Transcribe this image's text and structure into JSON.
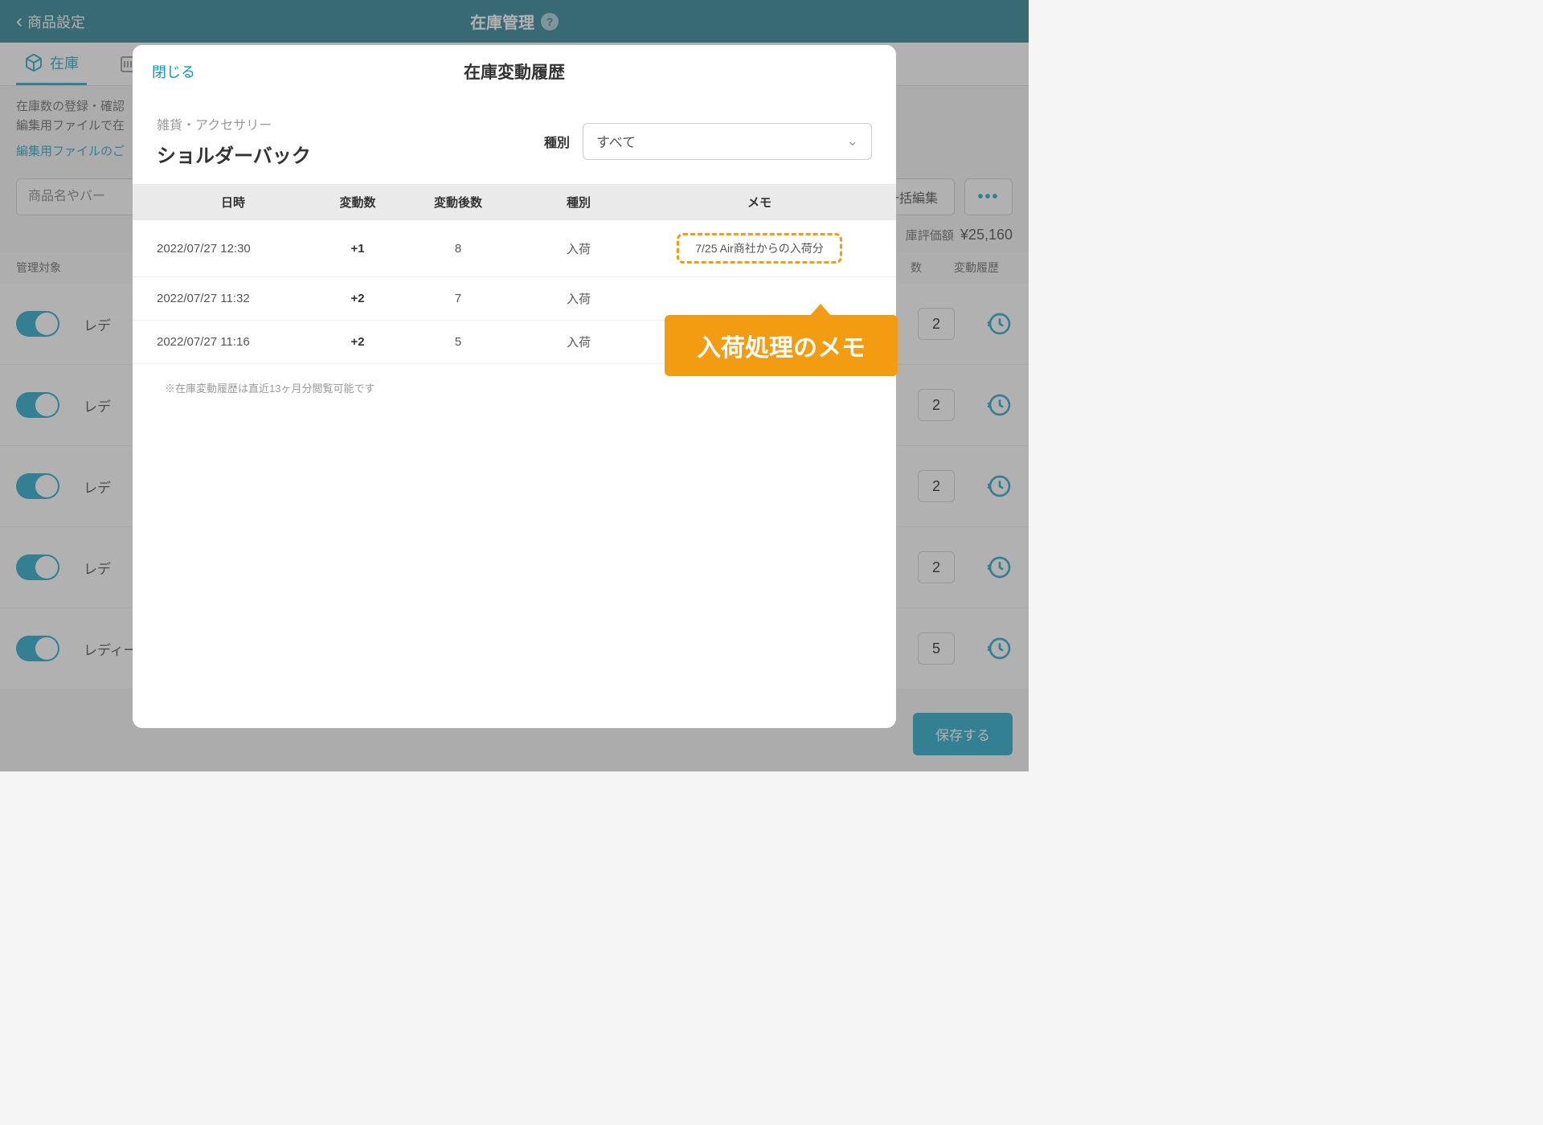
{
  "header": {
    "back_label": "商品設定",
    "title": "在庫管理"
  },
  "tabs": {
    "stock": "在庫"
  },
  "description": {
    "line1": "在庫数の登録・確認",
    "line2": "編集用ファイルで在",
    "link": "編集用ファイルのご"
  },
  "search": {
    "placeholder": "商品名やバー",
    "bulk_label": "一括編集",
    "more_label": "•••"
  },
  "summary": {
    "label": "庫評価額",
    "value": "¥25,160"
  },
  "table": {
    "col_target": "管理対象",
    "col_count": "数",
    "col_history": "変動履歴",
    "rows": [
      {
        "name": "レデ",
        "count": "2"
      },
      {
        "name": "レデ",
        "count": "2"
      },
      {
        "name": "レデ",
        "count": "2"
      },
      {
        "name": "レデ",
        "count": "2"
      },
      {
        "name": "レディース",
        "count": "5"
      }
    ]
  },
  "save_label": "保存する",
  "modal": {
    "close": "閉じる",
    "title": "在庫変動履歴",
    "category": "雑貨・アクセサリー",
    "product": "ショルダーバック",
    "filter_label": "種別",
    "filter_value": "すべて",
    "columns": {
      "date": "日時",
      "delta": "変動数",
      "after": "変動後数",
      "type": "種別",
      "memo": "メモ"
    },
    "rows": [
      {
        "date": "2022/07/27 12:30",
        "delta": "+1",
        "after": "8",
        "type": "入荷",
        "memo": "7/25 Air商社からの入荷分"
      },
      {
        "date": "2022/07/27 11:32",
        "delta": "+2",
        "after": "7",
        "type": "入荷",
        "memo": ""
      },
      {
        "date": "2022/07/27 11:16",
        "delta": "+2",
        "after": "5",
        "type": "入荷",
        "memo": ""
      }
    ],
    "note": "※在庫変動履歴は直近13ヶ月分閲覧可能です"
  },
  "callout": "入荷処理のメモ"
}
